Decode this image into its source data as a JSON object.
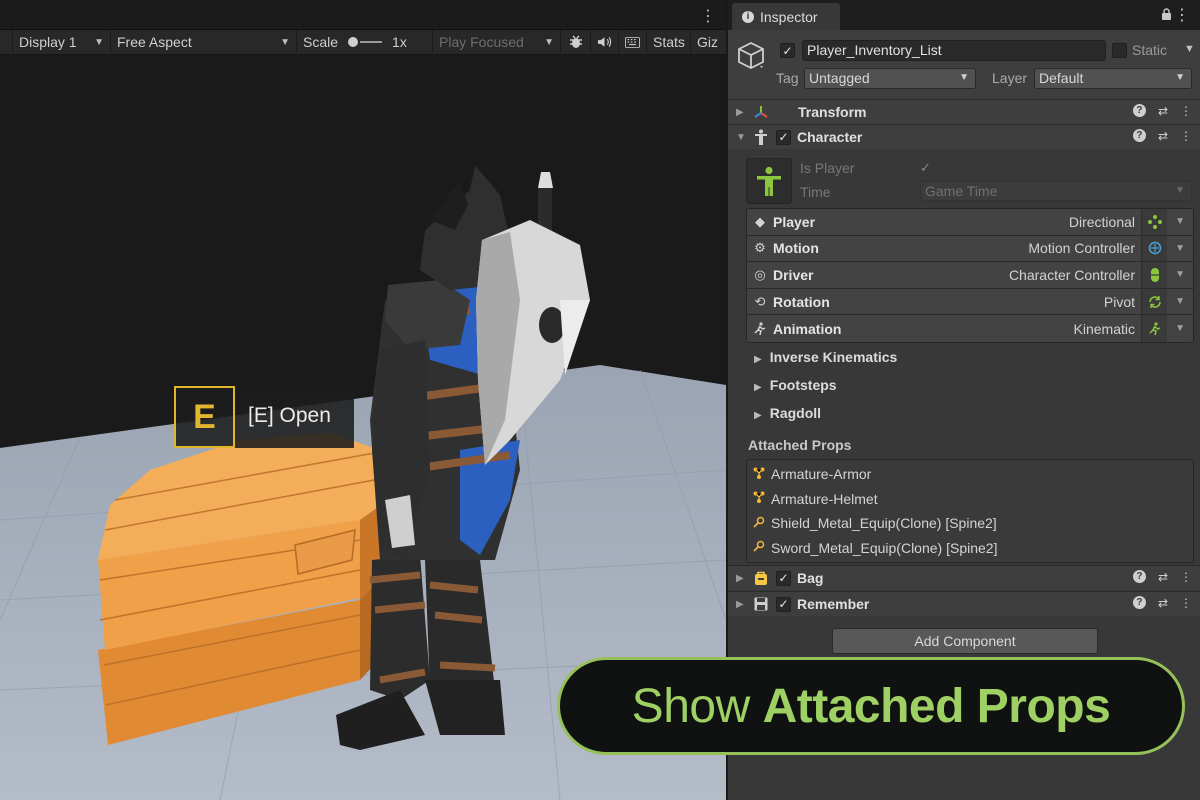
{
  "game_view": {
    "toolbar": {
      "display": "Display 1",
      "aspect": "Free Aspect",
      "scale_label": "Scale",
      "scale_value": "1x",
      "play_mode": "Play Focused",
      "stats": "Stats",
      "gizmos": "Giz"
    },
    "prompt": {
      "key": "E",
      "label": "[E] Open"
    }
  },
  "inspector": {
    "tab_label": "Inspector",
    "game_object": {
      "active": true,
      "name": "Player_Inventory_List",
      "static_label": "Static",
      "tag_label": "Tag",
      "tag_value": "Untagged",
      "layer_label": "Layer",
      "layer_value": "Default"
    },
    "transform": {
      "title": "Transform"
    },
    "character": {
      "title": "Character",
      "enabled": true,
      "is_player_label": "Is Player",
      "time_label": "Time",
      "time_value": "Game Time",
      "modules": [
        {
          "name": "Player",
          "value": "Directional",
          "icon": "dpad-icon"
        },
        {
          "name": "Motion",
          "value": "Motion Controller",
          "icon": "motion-icon"
        },
        {
          "name": "Driver",
          "value": "Character Controller",
          "icon": "capsule-icon"
        },
        {
          "name": "Rotation",
          "value": "Pivot",
          "icon": "rotate-icon"
        },
        {
          "name": "Animation",
          "value": "Kinematic",
          "icon": "running-icon"
        }
      ],
      "foldouts": [
        "Inverse Kinematics",
        "Footsteps",
        "Ragdoll"
      ],
      "attached_props_label": "Attached Props",
      "attached_props": [
        "Armature-Armor",
        "Armature-Helmet",
        "Shield_Metal_Equip(Clone) [Spine2]",
        "Sword_Metal_Equip(Clone) [Spine2]"
      ]
    },
    "bag": {
      "title": "Bag",
      "enabled": true
    },
    "remember": {
      "title": "Remember",
      "enabled": true
    },
    "add_component": "Add Component"
  },
  "banner": {
    "text_regular": "Show ",
    "text_bold": "Attached Props"
  },
  "colors": {
    "accent_green": "#9fd064",
    "prompt_gold": "#e2b52f",
    "chest_orange": "#f0a048",
    "knight_blue": "#2b5fc0"
  }
}
